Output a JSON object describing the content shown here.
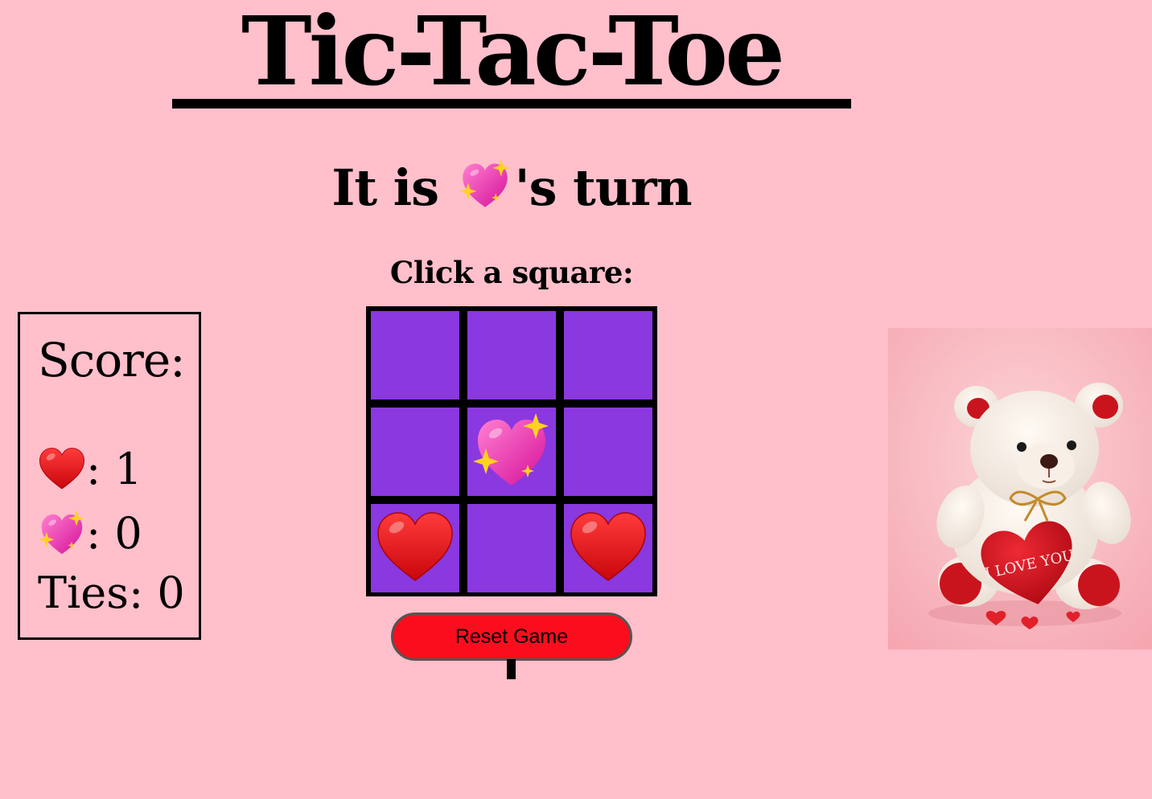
{
  "title": "Tic-Tac-Toe",
  "turn": {
    "prefix": "It is ",
    "player_icon": "sparkling-heart-icon",
    "suffix": "'s turn"
  },
  "prompt": "Click a square:",
  "board": {
    "cells": [
      "",
      "",
      "",
      "",
      "sparkling-heart",
      "",
      "red-heart",
      "",
      "red-heart"
    ],
    "cell_color": "#8a38df",
    "grid_color": "#000000"
  },
  "score": {
    "title": "Score:",
    "red_heart_score": ": 1",
    "sparkling_heart_score": ": 0",
    "ties": "Ties: 0"
  },
  "reset_button": "Reset Game",
  "image": {
    "description_text": "I LOVE YOU"
  },
  "colors": {
    "background": "#ffbfcb",
    "board": "#8a38df",
    "reset_button": "#fa0e1d"
  }
}
